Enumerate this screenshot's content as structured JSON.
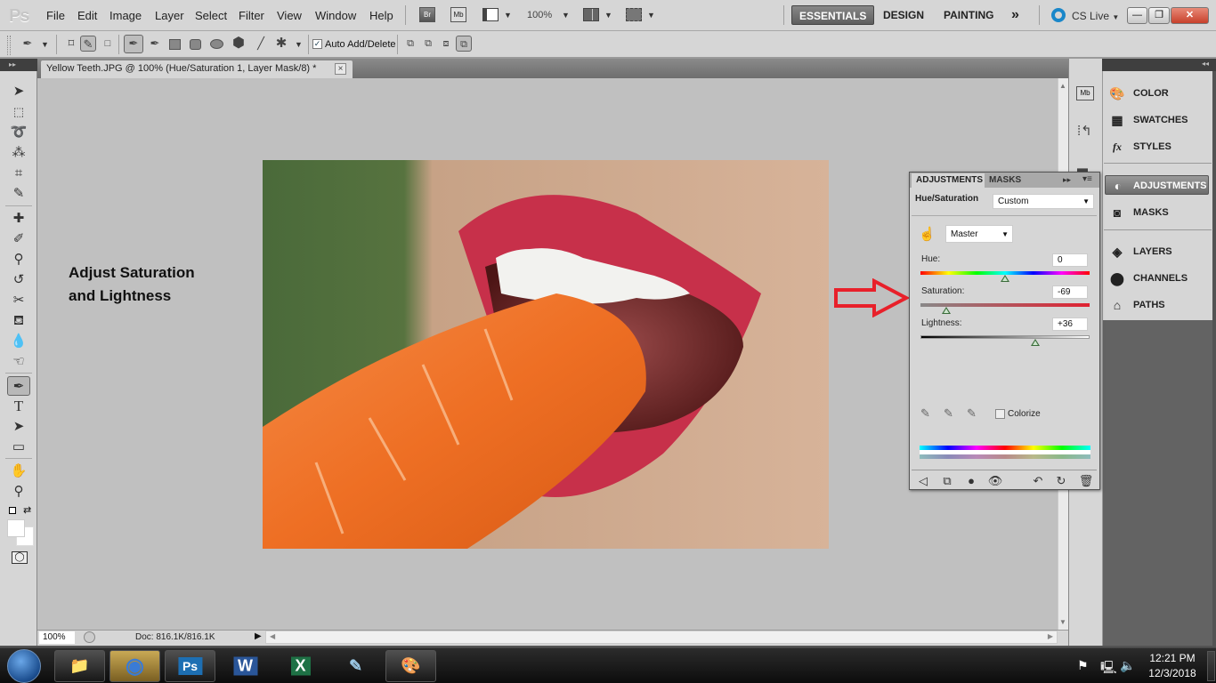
{
  "app": {
    "logo": "Ps"
  },
  "menu": [
    "File",
    "Edit",
    "Image",
    "Layer",
    "Select",
    "Filter",
    "View",
    "Window",
    "Help"
  ],
  "appbar": {
    "bridge": "Br",
    "minibridge": "Mb",
    "zoom": "100%"
  },
  "workspaces": {
    "essentials": "ESSENTIALS",
    "design": "DESIGN",
    "painting": "PAINTING",
    "more": "»",
    "cslive": "CS Live"
  },
  "window_controls": {
    "minimize": "—",
    "restore": "❐",
    "close": "✕"
  },
  "options": {
    "auto_add_delete_label": "Auto Add/Delete",
    "auto_add_delete_checked": true
  },
  "document": {
    "tab_title": "Yellow Teeth.JPG @ 100% (Hue/Saturation 1, Layer Mask/8) *",
    "close": "×",
    "zoom": "100%",
    "doc_info": "Doc: 816.1K/816.1K"
  },
  "annotation": {
    "line1": "Adjust Saturation",
    "line2": "and Lightness"
  },
  "dock_panels": [
    {
      "label": "COLOR",
      "icon": "palette-icon"
    },
    {
      "label": "SWATCHES",
      "icon": "swatches-icon"
    },
    {
      "label": "STYLES",
      "icon": "fx-icon"
    },
    {
      "label": "ADJUSTMENTS",
      "icon": "adjustments-icon",
      "selected": true
    },
    {
      "label": "MASKS",
      "icon": "mask-icon"
    },
    {
      "label": "LAYERS",
      "icon": "layers-icon"
    },
    {
      "label": "CHANNELS",
      "icon": "channels-icon"
    },
    {
      "label": "PATHS",
      "icon": "paths-icon"
    }
  ],
  "adjustments": {
    "tabs": {
      "adjustments": "ADJUSTMENTS",
      "masks": "MASKS"
    },
    "title": "Hue/Saturation",
    "preset": "Custom",
    "channel": "Master",
    "hue": {
      "label": "Hue:",
      "value": "0",
      "min": -180,
      "max": 180
    },
    "saturation": {
      "label": "Saturation:",
      "value": "-69",
      "min": -100,
      "max": 100
    },
    "lightness": {
      "label": "Lightness:",
      "value": "+36",
      "min": -100,
      "max": 100
    },
    "colorize": {
      "label": "Colorize",
      "checked": false
    }
  },
  "taskbar": {
    "apps": [
      {
        "name": "explorer",
        "glyph": "📁"
      },
      {
        "name": "chrome",
        "glyph": "◉",
        "active": true
      },
      {
        "name": "photoshop",
        "glyph": "Ps"
      },
      {
        "name": "word",
        "glyph": "W"
      },
      {
        "name": "excel",
        "glyph": "X"
      },
      {
        "name": "notepad",
        "glyph": "✎"
      },
      {
        "name": "paint",
        "glyph": "🎨"
      }
    ],
    "time": "12:21 PM",
    "date": "12/3/2018"
  }
}
